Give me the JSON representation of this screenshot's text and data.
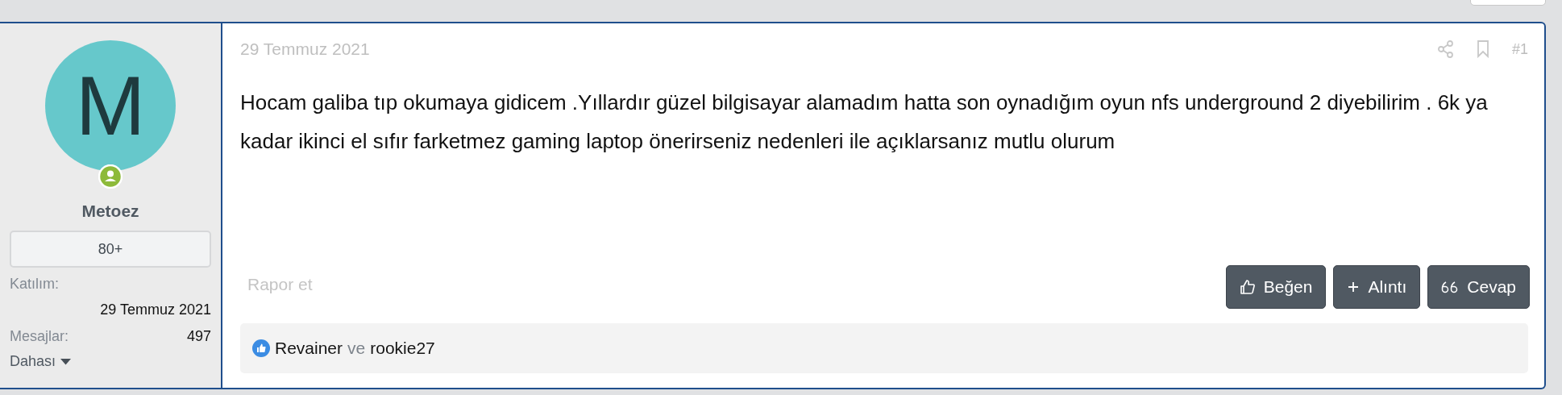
{
  "author": {
    "initial": "M",
    "online": true,
    "name": "Metoez",
    "badge": "80+",
    "stats": [
      {
        "label": "Katılım:",
        "value": "29 Temmuz 2021",
        "kind": "stacked"
      },
      {
        "label": "Mesajlar:",
        "value": "497",
        "kind": "inline"
      }
    ],
    "more": "Dahası"
  },
  "post": {
    "date": "29 Temmuz 2021",
    "number": "#1",
    "body": "Hocam galiba tıp okumaya gidicem .Yıllardır güzel bilgisayar alamadım hatta son oynadığım oyun nfs underground 2 diyebilirim . 6k ya kadar ikinci el sıfır farketmez gaming laptop önerirseniz nedenleri ile açıklarsanız mutlu olurum",
    "report": "Rapor et",
    "actions": [
      {
        "label": "Beğen",
        "kind": "like"
      },
      {
        "label": "Alıntı",
        "kind": "quote"
      },
      {
        "label": "Cevap",
        "kind": "reply"
      }
    ],
    "likes": {
      "users": [
        "Revainer",
        "rookie27"
      ],
      "joiner": "ve"
    }
  }
}
